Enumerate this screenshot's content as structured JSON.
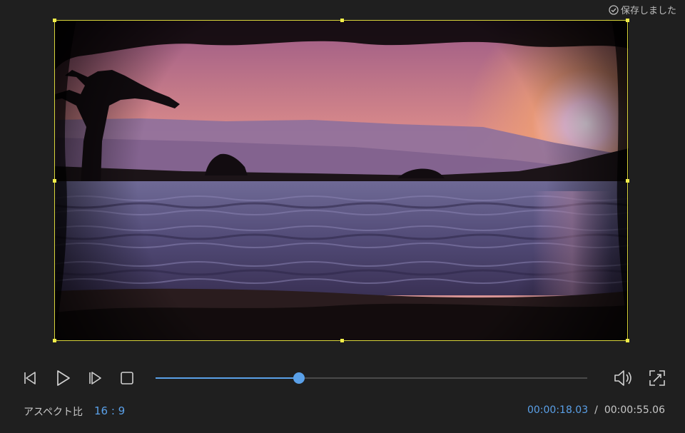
{
  "header": {
    "saved_status": "保存しました",
    "saved_icon": "check-circle-icon"
  },
  "preview": {
    "scene": "sunset-lake-vignette",
    "selection_color": "#d8d43a"
  },
  "controls": {
    "prev_frame_icon": "step-back-icon",
    "play_icon": "play-icon",
    "next_frame_icon": "step-forward-icon",
    "stop_icon": "stop-icon",
    "volume_icon": "volume-icon",
    "fullscreen_icon": "fullscreen-icon",
    "progress_fraction": 0.3327
  },
  "footer": {
    "aspect_label": "アスペクト比",
    "aspect_value": "16 : 9",
    "time_current": "00:00:18.03",
    "time_separator": "/",
    "time_total": "00:00:55.06"
  },
  "colors": {
    "accent": "#5aa0e8",
    "background": "#1f1f1f",
    "text": "#c7c7c7"
  }
}
